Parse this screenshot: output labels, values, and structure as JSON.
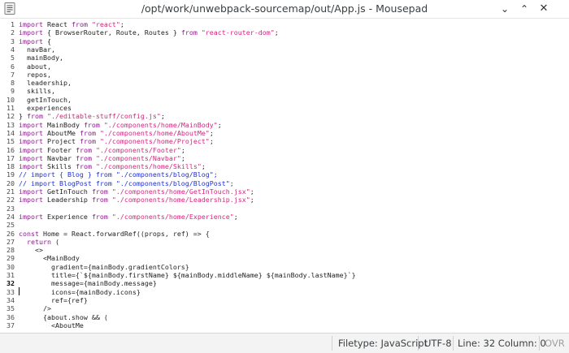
{
  "window": {
    "title": "/opt/work/unwebpack-sourcemap/out/App.js - Mousepad",
    "min_icon": "⌄",
    "max_icon": "⌃",
    "close_icon": "✕"
  },
  "editor": {
    "current_line": 32,
    "lines": [
      [
        [
          "import",
          "k"
        ],
        [
          " React ",
          "t"
        ],
        [
          "from",
          "k"
        ],
        [
          " ",
          "t"
        ],
        [
          "\"react\"",
          "s"
        ],
        [
          ";",
          "t"
        ]
      ],
      [
        [
          "import",
          "k"
        ],
        [
          " { BrowserRouter, Route, Routes } ",
          "t"
        ],
        [
          "from",
          "k"
        ],
        [
          " ",
          "t"
        ],
        [
          "\"react-router-dom\"",
          "s"
        ],
        [
          ";",
          "t"
        ]
      ],
      [
        [
          "import",
          "k"
        ],
        [
          " {",
          "t"
        ]
      ],
      [
        [
          "  navBar,",
          "t"
        ]
      ],
      [
        [
          "  mainBody,",
          "t"
        ]
      ],
      [
        [
          "  about,",
          "t"
        ]
      ],
      [
        [
          "  repos,",
          "t"
        ]
      ],
      [
        [
          "  leadership,",
          "t"
        ]
      ],
      [
        [
          "  skills,",
          "t"
        ]
      ],
      [
        [
          "  getInTouch,",
          "t"
        ]
      ],
      [
        [
          "  experiences",
          "t"
        ]
      ],
      [
        [
          "} ",
          "t"
        ],
        [
          "from",
          "k"
        ],
        [
          " ",
          "t"
        ],
        [
          "\"./editable-stuff/config.js\"",
          "s"
        ],
        [
          ";",
          "t"
        ]
      ],
      [
        [
          "import",
          "k"
        ],
        [
          " MainBody ",
          "t"
        ],
        [
          "from",
          "k"
        ],
        [
          " ",
          "t"
        ],
        [
          "\"./components/home/MainBody\"",
          "s"
        ],
        [
          ";",
          "t"
        ]
      ],
      [
        [
          "import",
          "k"
        ],
        [
          " AboutMe ",
          "t"
        ],
        [
          "from",
          "k"
        ],
        [
          " ",
          "t"
        ],
        [
          "\"./components/home/AboutMe\"",
          "s"
        ],
        [
          ";",
          "t"
        ]
      ],
      [
        [
          "import",
          "k"
        ],
        [
          " Project ",
          "t"
        ],
        [
          "from",
          "k"
        ],
        [
          " ",
          "t"
        ],
        [
          "\"./components/home/Project\"",
          "s"
        ],
        [
          ";",
          "t"
        ]
      ],
      [
        [
          "import",
          "k"
        ],
        [
          " Footer ",
          "t"
        ],
        [
          "from",
          "k"
        ],
        [
          " ",
          "t"
        ],
        [
          "\"./components/Footer\"",
          "s"
        ],
        [
          ";",
          "t"
        ]
      ],
      [
        [
          "import",
          "k"
        ],
        [
          " Navbar ",
          "t"
        ],
        [
          "from",
          "k"
        ],
        [
          " ",
          "t"
        ],
        [
          "\"./components/Navbar\"",
          "s"
        ],
        [
          ";",
          "t"
        ]
      ],
      [
        [
          "import",
          "k"
        ],
        [
          " Skills ",
          "t"
        ],
        [
          "from",
          "k"
        ],
        [
          " ",
          "t"
        ],
        [
          "\"./components/home/Skills\"",
          "s"
        ],
        [
          ";",
          "t"
        ]
      ],
      [
        [
          "// import { Blog } from \"./components/blog/Blog\";",
          "c"
        ]
      ],
      [
        [
          "// import BlogPost from \"./components/blog/BlogPost\";",
          "c"
        ]
      ],
      [
        [
          "import",
          "k"
        ],
        [
          " GetInTouch ",
          "t"
        ],
        [
          "from",
          "k"
        ],
        [
          " ",
          "t"
        ],
        [
          "\"./components/home/GetInTouch.jsx\"",
          "s"
        ],
        [
          ";",
          "t"
        ]
      ],
      [
        [
          "import",
          "k"
        ],
        [
          " Leadership ",
          "t"
        ],
        [
          "from",
          "k"
        ],
        [
          " ",
          "t"
        ],
        [
          "\"./components/home/Leadership.jsx\"",
          "s"
        ],
        [
          ";",
          "t"
        ]
      ],
      [],
      [
        [
          "import",
          "k"
        ],
        [
          " Experience ",
          "t"
        ],
        [
          "from",
          "k"
        ],
        [
          " ",
          "t"
        ],
        [
          "\"./components/home/Experience\"",
          "s"
        ],
        [
          ";",
          "t"
        ]
      ],
      [],
      [
        [
          "const",
          "k"
        ],
        [
          " Home = React.forwardRef((props, ref) => {",
          "t"
        ]
      ],
      [
        [
          "  ",
          "t"
        ],
        [
          "return",
          "k"
        ],
        [
          " (",
          "t"
        ]
      ],
      [
        [
          "    <>",
          "t"
        ]
      ],
      [
        [
          "      <MainBody",
          "t"
        ]
      ],
      [
        [
          "        gradient={mainBody.gradientColors}",
          "t"
        ]
      ],
      [
        [
          "        title={`${mainBody.firstName} ${mainBody.middleName} ${mainBody.lastName}`}",
          "t"
        ]
      ],
      [
        [
          "        message={mainBody.message}",
          "t"
        ]
      ],
      [
        [
          "        icons={mainBody.icons}",
          "t"
        ]
      ],
      [
        [
          "        ref={ref}",
          "t"
        ]
      ],
      [
        [
          "      />",
          "t"
        ]
      ],
      [
        [
          "      {about.show && (",
          "t"
        ]
      ],
      [
        [
          "        <AboutMe",
          "t"
        ]
      ]
    ]
  },
  "statusbar": {
    "filetype": "Filetype: JavaScript",
    "encoding": "UTF-8",
    "position": "Line: 32 Column: 0",
    "mode": "OVR"
  },
  "colors": {
    "keyword": "#8b1a8b",
    "string": "#d6237e",
    "comment": "#1f2fd0",
    "text": "#222222"
  }
}
